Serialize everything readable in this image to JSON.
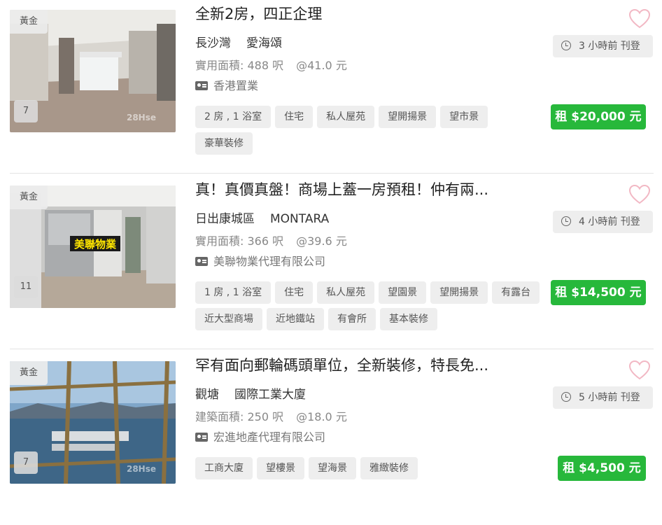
{
  "listings": [
    {
      "badge": "黃金",
      "photo_count": "7",
      "watermark": "28Hse",
      "title": "全新2房，四正企理",
      "district": "長沙灣",
      "estate": "愛海頌",
      "area_label": "實用面積: 488 呎",
      "unit_price": "@41.0 元",
      "agency": "香港置業",
      "tags": [
        "2 房 , 1 浴室",
        "住宅",
        "私人屋苑",
        "望開揚景",
        "望市景",
        "豪華裝修"
      ],
      "posted": "3 小時前 刊登",
      "price": "租 $20,000 元"
    },
    {
      "badge": "黃金",
      "photo_count": "11",
      "watermark": "",
      "photo_label": "美聯物業",
      "title": "真！真價真盤！商場上蓋一房預租！仲有兩...",
      "district": "日出康城區",
      "estate": "MONTARA",
      "area_label": "實用面積: 366 呎",
      "unit_price": "@39.6 元",
      "agency": "美聯物業代理有限公司",
      "tags": [
        "1 房 , 1 浴室",
        "住宅",
        "私人屋苑",
        "望園景",
        "望開揚景",
        "有露台",
        "近大型商場",
        "近地鐵站",
        "有會所",
        "基本裝修"
      ],
      "posted": "4 小時前 刊登",
      "price": "租 $14,500 元"
    },
    {
      "badge": "黃金",
      "photo_count": "7",
      "watermark": "28Hse",
      "title": "罕有面向郵輪碼頭單位，全新裝修，特長免...",
      "district": "觀塘",
      "estate": "國際工業大廈",
      "area_label": "建築面積: 250 呎",
      "unit_price": "@18.0 元",
      "agency": "宏進地產代理有限公司",
      "tags": [
        "工商大廈",
        "望樓景",
        "望海景",
        "雅緻裝修"
      ],
      "posted": "5 小時前 刊登",
      "price": "租 $4,500 元"
    }
  ],
  "colors": {
    "price_green": "#27b83b",
    "heart_pink": "#f2b8c4"
  }
}
